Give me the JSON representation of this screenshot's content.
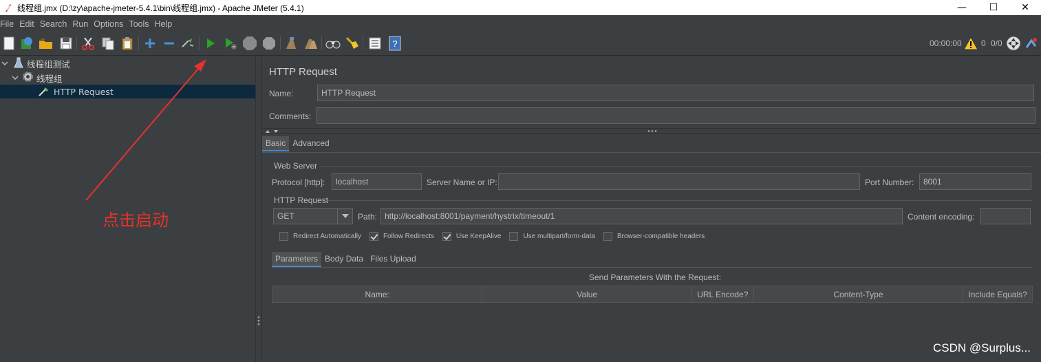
{
  "window": {
    "title": "线程组.jmx (D:\\zy\\apache-jmeter-5.4.1\\bin\\线程组.jmx) - Apache JMeter (5.4.1)",
    "minimize": "—",
    "maximize": "☐",
    "close": "✕"
  },
  "menu": [
    "File",
    "Edit",
    "Search",
    "Run",
    "Options",
    "Tools",
    "Help"
  ],
  "toolbar": {
    "timer": "00:00:00",
    "warnings": "0",
    "threads": "0/0"
  },
  "tree": {
    "root": "线程组测试",
    "group": "线程组",
    "sampler": "HTTP Request"
  },
  "panel": {
    "title": "HTTP Request",
    "name_label": "Name:",
    "name_value": "HTTP Request",
    "comments_label": "Comments:",
    "comments_value": "",
    "tabs": [
      "Basic",
      "Advanced"
    ],
    "web_server": {
      "group_label": "Web Server",
      "protocol_label": "Protocol [http]:",
      "protocol_value": "localhost",
      "server_label": "Server Name or IP:",
      "server_value": "",
      "port_label": "Port Number:",
      "port_value": "8001"
    },
    "http_request": {
      "group_label": "HTTP Request",
      "method": "GET",
      "path_label": "Path:",
      "path_value": "http://localhost:8001/payment/hystrix/timeout/1",
      "encoding_label": "Content encoding:",
      "encoding_value": ""
    },
    "checkboxes": [
      {
        "label": "Redirect Automatically",
        "checked": false
      },
      {
        "label": "Follow Redirects",
        "checked": true
      },
      {
        "label": "Use KeepAlive",
        "checked": true
      },
      {
        "label": "Use multipart/form-data",
        "checked": false
      },
      {
        "label": "Browser-compatible headers",
        "checked": false
      }
    ],
    "subtabs": [
      "Parameters",
      "Body Data",
      "Files Upload"
    ],
    "table_caption": "Send Parameters With the Request:",
    "columns": [
      "Name:",
      "Value",
      "URL Encode?",
      "Content-Type",
      "Include Equals?"
    ]
  },
  "annotation": {
    "text": "点击启动",
    "color": "#e8312b"
  },
  "watermark": "CSDN @Surplus..."
}
